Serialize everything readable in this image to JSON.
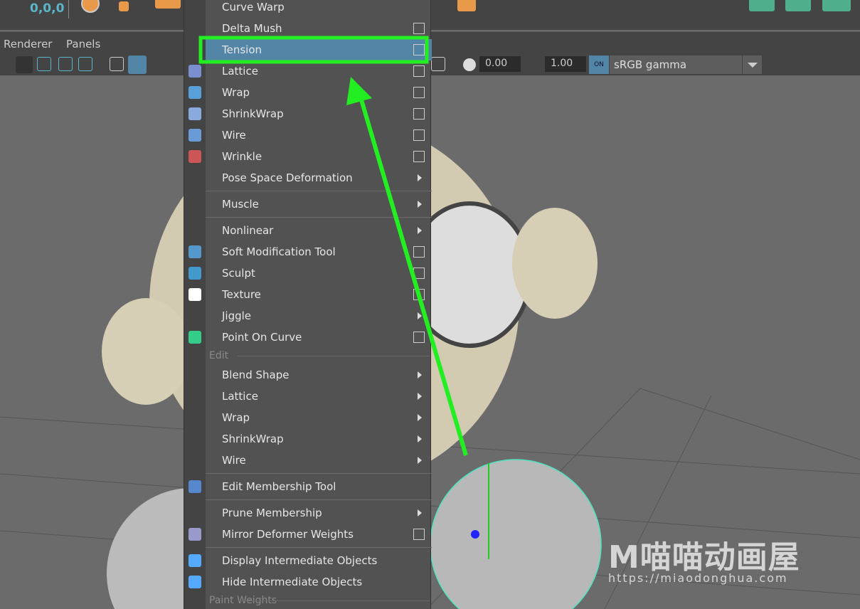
{
  "toolbar": {
    "coord_label": "0,0,0"
  },
  "menubar": {
    "items": [
      "Renderer",
      "Panels"
    ]
  },
  "viewbar": {
    "exposure": "0.00",
    "gamma": "1.00",
    "on_label": "ON",
    "color_space": "sRGB gamma"
  },
  "menu": {
    "items": [
      {
        "label": "Curve Warp",
        "kind": "none"
      },
      {
        "label": "Delta Mush",
        "kind": "box"
      },
      {
        "label": "Tension",
        "kind": "box",
        "highlighted": true
      },
      {
        "label": "Lattice",
        "kind": "box",
        "icon": "lattice-icon"
      },
      {
        "label": "Wrap",
        "kind": "box",
        "icon": "wrap-icon"
      },
      {
        "label": "ShrinkWrap",
        "kind": "box",
        "icon": "shrinkwrap-icon"
      },
      {
        "label": "Wire",
        "kind": "box",
        "icon": "wire-icon"
      },
      {
        "label": "Wrinkle",
        "kind": "box",
        "icon": "wrinkle-icon"
      },
      {
        "label": "Pose Space Deformation",
        "kind": "arrow"
      },
      {
        "sep": true
      },
      {
        "label": "Muscle",
        "kind": "arrow"
      },
      {
        "sep": true
      },
      {
        "label": "Nonlinear",
        "kind": "arrow"
      },
      {
        "label": "Soft Modification Tool",
        "kind": "box",
        "icon": "soft-mod-icon"
      },
      {
        "label": "Sculpt",
        "kind": "box",
        "icon": "sculpt-icon"
      },
      {
        "label": "Texture",
        "kind": "box",
        "icon": "texture-icon"
      },
      {
        "label": "Jiggle",
        "kind": "arrow"
      },
      {
        "label": "Point On Curve",
        "kind": "box",
        "icon": "point-on-curve-icon"
      },
      {
        "section": "Edit"
      },
      {
        "label": "Blend Shape",
        "kind": "arrow"
      },
      {
        "label": "Lattice",
        "kind": "arrow"
      },
      {
        "label": "Wrap",
        "kind": "arrow"
      },
      {
        "label": "ShrinkWrap",
        "kind": "arrow"
      },
      {
        "label": "Wire",
        "kind": "arrow"
      },
      {
        "sep": true
      },
      {
        "label": "Edit Membership Tool",
        "kind": "none",
        "icon": "edit-membership-icon"
      },
      {
        "sep": true
      },
      {
        "label": "Prune Membership",
        "kind": "arrow"
      },
      {
        "label": "Mirror Deformer Weights",
        "kind": "box",
        "icon": "mirror-weights-icon"
      },
      {
        "sep": true
      },
      {
        "label": "Display Intermediate Objects",
        "kind": "none",
        "icon": "display-intermediate-icon"
      },
      {
        "label": "Hide Intermediate Objects",
        "kind": "none",
        "icon": "hide-intermediate-icon"
      },
      {
        "section": "Paint Weights"
      }
    ]
  },
  "watermark": {
    "brand": "M喵喵动画屋",
    "url": "https://miaodonghua.com"
  },
  "colors": {
    "highlight": "#5285a6",
    "annotation": "#22ee22"
  }
}
